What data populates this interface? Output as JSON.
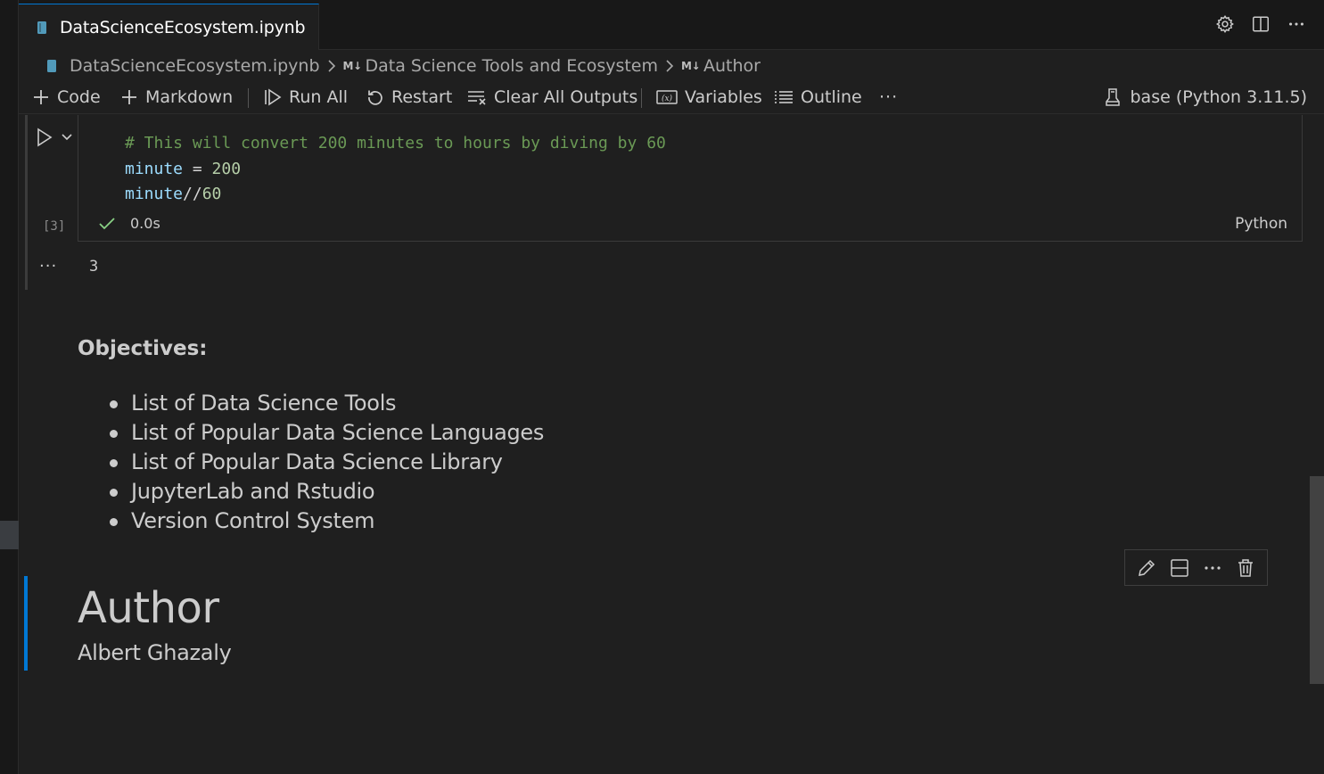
{
  "tab": {
    "title": "DataScienceEcosystem.ipynb"
  },
  "breadcrumb": {
    "file": "DataScienceEcosystem.ipynb",
    "md_badge_1": "M↓",
    "section": "Data Science Tools and Ecosystem",
    "md_badge_2": "M↓",
    "subsection": "Author"
  },
  "toolbar": {
    "code": "Code",
    "markdown": "Markdown",
    "run_all": "Run All",
    "restart": "Restart",
    "clear_all_outputs": "Clear All Outputs",
    "variables": "Variables",
    "outline": "Outline",
    "more": "···",
    "kernel": "base (Python 3.11.5)"
  },
  "code_cell": {
    "execution_count": "[3]",
    "lines": {
      "comment": "# This will convert 200 minutes to hours by diving by 60",
      "l2_var": "minute",
      "l2_op": " = ",
      "l2_num": "200",
      "l3_var": "minute",
      "l3_op": "//",
      "l3_num": "60"
    },
    "status_time": "0.0s",
    "language": "Python",
    "output_more": "···",
    "output": "3"
  },
  "objectives": {
    "heading": "Objectives:",
    "items": [
      "List of Data Science Tools",
      "List of Popular Data Science Languages",
      "List of Popular Data Science Library",
      "JupyterLab and Rstudio",
      "Version Control System"
    ]
  },
  "author_cell": {
    "heading": "Author",
    "name": "Albert Ghazaly"
  },
  "colors": {
    "accent": "#0078d4",
    "background": "#1f1f1f",
    "success": "#89d185",
    "comment": "#6a9955",
    "variable": "#9cdcfe",
    "number": "#b5cea8"
  }
}
